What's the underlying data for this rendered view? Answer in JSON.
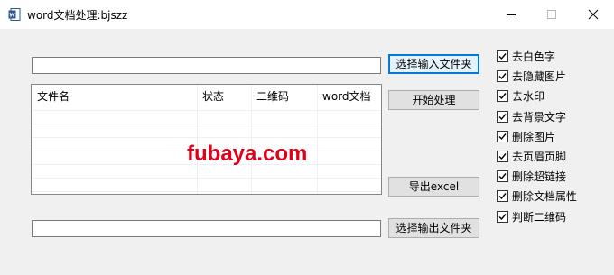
{
  "window": {
    "title": "word文档处理:bjszz",
    "app_icon": "word-icon"
  },
  "input_path": {
    "value": ""
  },
  "output_path": {
    "value": ""
  },
  "buttons": {
    "select_input": "选择输入文件夹",
    "start": "开始处理",
    "export": "导出excel",
    "select_output": "选择输出文件夹"
  },
  "table": {
    "columns": [
      "文件名",
      "状态",
      "二维码",
      "word文档"
    ],
    "rows": []
  },
  "watermark": "fubaya.com",
  "options": [
    {
      "label": "去白色字",
      "checked": true
    },
    {
      "label": "去隐藏图片",
      "checked": true
    },
    {
      "label": "去水印",
      "checked": true
    },
    {
      "label": "去背景文字",
      "checked": true
    },
    {
      "label": "删除图片",
      "checked": true
    },
    {
      "label": "去页眉页脚",
      "checked": true
    },
    {
      "label": "删除超链接",
      "checked": true
    },
    {
      "label": "删除文档属性",
      "checked": true
    },
    {
      "label": "判断二维码",
      "checked": true
    }
  ],
  "colors": {
    "watermark": "#e0001b",
    "focus": "#0078d7",
    "icon": "#2b579a"
  }
}
